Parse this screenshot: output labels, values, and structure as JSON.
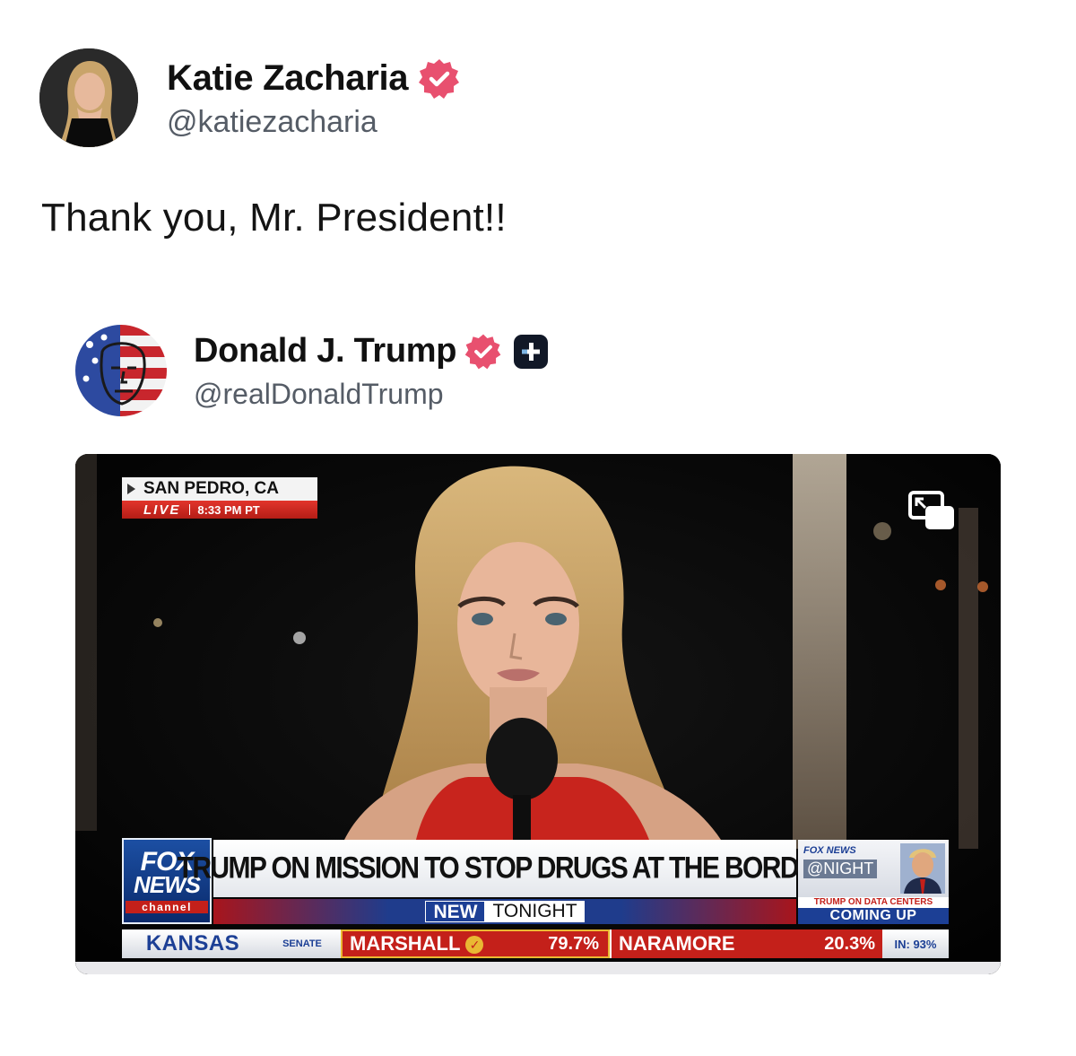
{
  "post": {
    "author": {
      "name": "Katie Zacharia",
      "handle": "@katiezacharia",
      "verified": true
    },
    "text": "Thank you, Mr. President!!"
  },
  "quoted_post": {
    "author": {
      "name": "Donald J. Trump",
      "handle": "@realDonaldTrump",
      "verified": true
    },
    "media": {
      "type": "video",
      "location": "SAN PEDRO, CA",
      "live_label": "LIVE",
      "time": "8:33 PM PT",
      "network": {
        "line1": "FOX",
        "line2": "NEWS",
        "line3": "channel"
      },
      "headline": "TRUMP ON MISSION TO STOP DRUGS AT THE BORDER",
      "tag_new": "NEW",
      "tag_tonight": "TONIGHT",
      "promo": {
        "brand": "FOX NEWS",
        "show": "@NIGHT",
        "topic": "TRUMP ON DATA CENTERS",
        "status": "COMING UP"
      },
      "ticker": {
        "state": "KANSAS",
        "race": "SENATE",
        "candidates": [
          {
            "name": "MARSHALL",
            "pct": "79.7%",
            "winner": true
          },
          {
            "name": "NARAMORE",
            "pct": "20.3%",
            "winner": false
          }
        ],
        "reporting": "IN: 93%"
      }
    }
  },
  "colors": {
    "verified_badge": "#e8506f",
    "fox_blue": "#1c3f95",
    "fox_red": "#c4201a",
    "winner_gold": "#e9b833"
  },
  "icons": {
    "verified": "verified-badge-icon",
    "plus": "plus-badge-icon",
    "pip": "picture-in-picture-icon"
  }
}
